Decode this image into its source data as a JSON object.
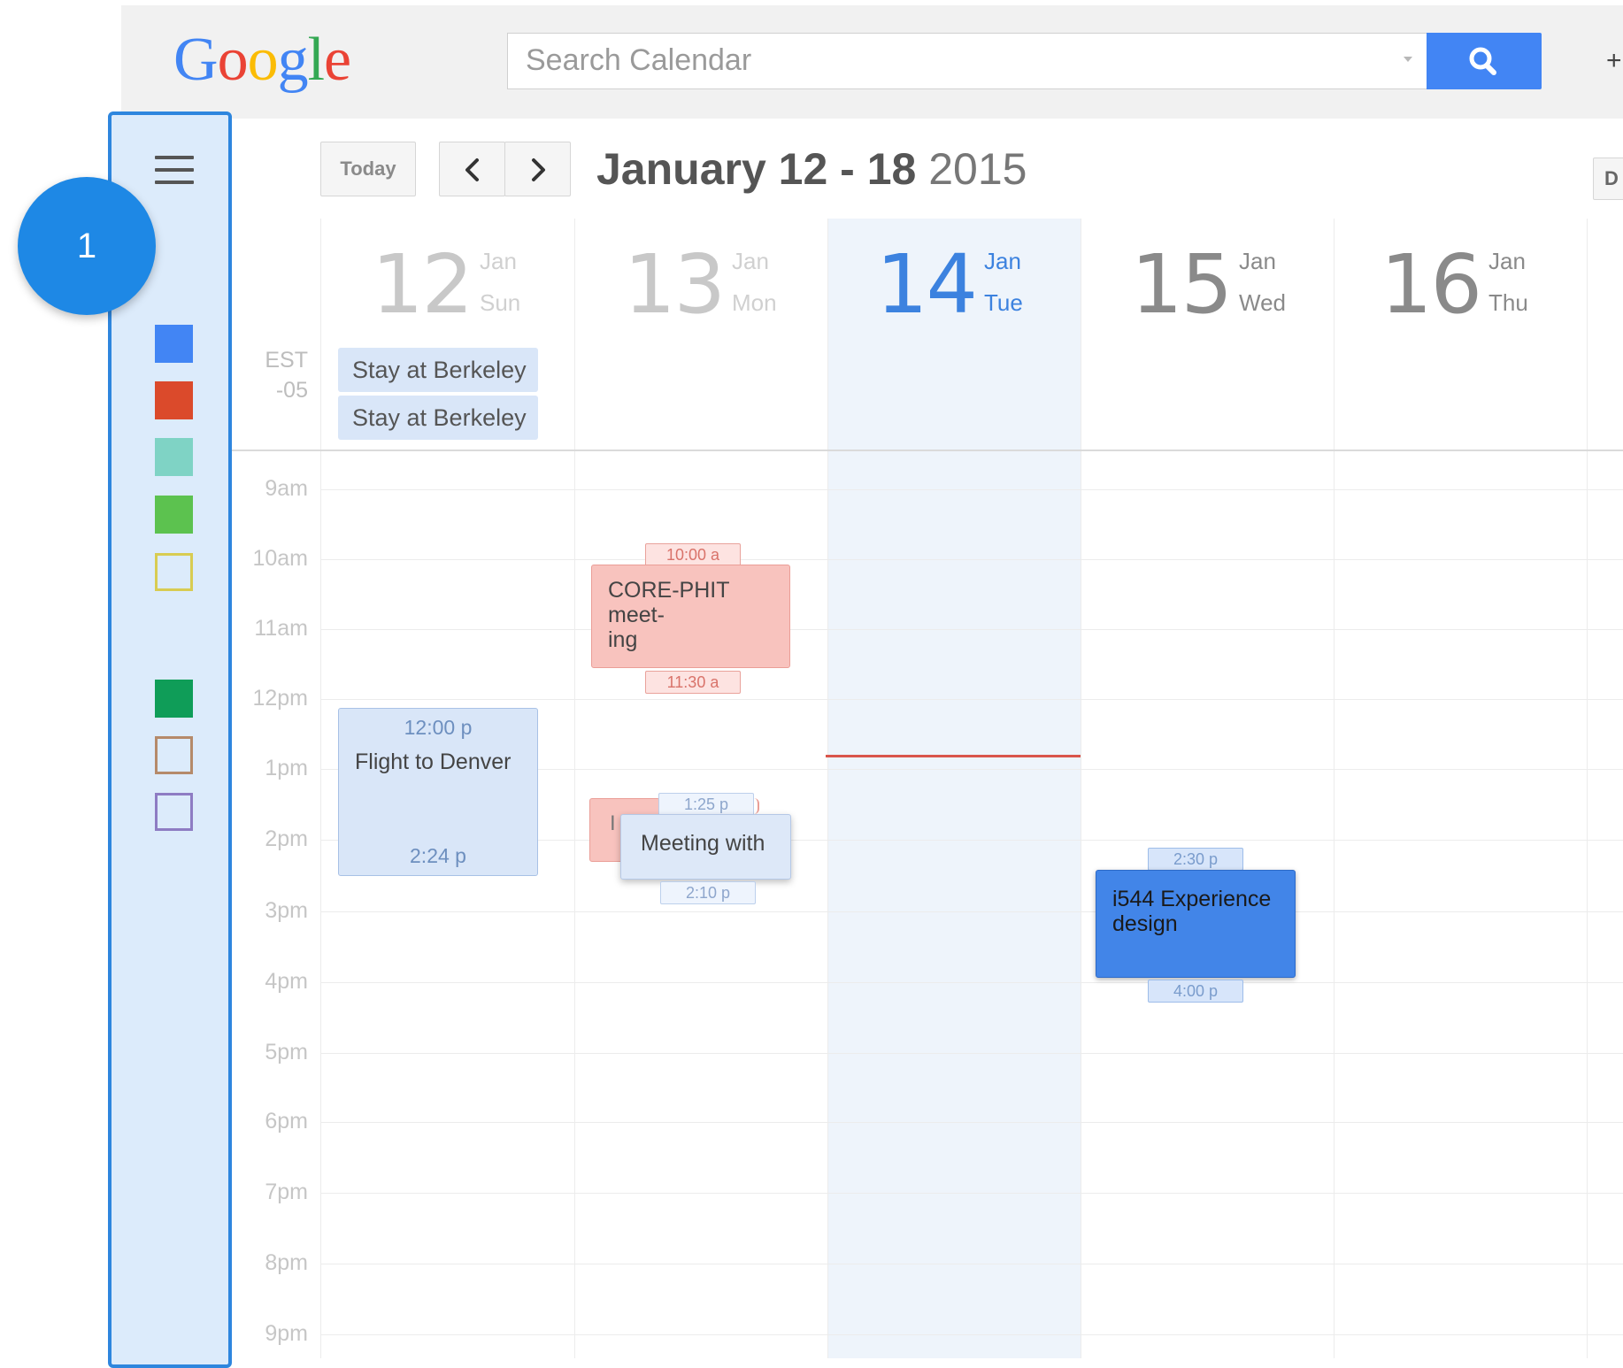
{
  "header": {
    "logo_letters": [
      "G",
      "o",
      "o",
      "g",
      "l",
      "e"
    ],
    "search_placeholder": "Search Calendar",
    "top_right_fragment": "+"
  },
  "toolbar": {
    "today_label": "Today",
    "prev_icon": "chevron-left-icon",
    "next_icon": "chevron-right-icon",
    "range_main": "January 12 - 18",
    "range_year": "2015",
    "view_fragment": "D"
  },
  "timezone": {
    "line1": "EST",
    "line2": "-05"
  },
  "days": [
    {
      "num": "12",
      "month": "Jan",
      "weekday": "Sun"
    },
    {
      "num": "13",
      "month": "Jan",
      "weekday": "Mon"
    },
    {
      "num": "14",
      "month": "Jan",
      "weekday": "Tue"
    },
    {
      "num": "15",
      "month": "Jan",
      "weekday": "Wed"
    },
    {
      "num": "16",
      "month": "Jan",
      "weekday": "Thu"
    }
  ],
  "hours": [
    "9am",
    "10am",
    "11am",
    "12pm",
    "1pm",
    "2pm",
    "3pm",
    "4pm",
    "5pm",
    "6pm",
    "7pm",
    "8pm",
    "9pm"
  ],
  "allday_events": [
    "Stay at Berkeley",
    "Stay at Berkeley"
  ],
  "events": {
    "core_phit": {
      "title": "CORE-PHIT meet-\ning",
      "start": "10:00 a",
      "end": "11:30 a"
    },
    "flight": {
      "title": "Flight to Denver",
      "start": "12:00 p",
      "end": "2:24 p"
    },
    "hidden_event": {
      "title": "I"
    },
    "meeting": {
      "title": "Meeting with",
      "start": "1:25 p",
      "end": "2:10 p"
    },
    "i544": {
      "title": "i544 Experience\ndesign",
      "start": "2:30 p",
      "end": "4:00 p"
    }
  },
  "sidebar": {
    "menu_icon": "hamburger-menu-icon",
    "calendar_colors": [
      {
        "color": "#4285f4",
        "filled": true
      },
      {
        "color": "#db4a2b",
        "filled": true
      },
      {
        "color": "#7fd3c5",
        "filled": true
      },
      {
        "color": "#5cc24f",
        "filled": true
      },
      {
        "color": "#d8cc52",
        "filled": false
      },
      {
        "color": "#0f9d58",
        "filled": true
      },
      {
        "color": "#b58a6a",
        "filled": false
      },
      {
        "color": "#8e7cc3",
        "filled": false
      }
    ],
    "step_badge": "1"
  },
  "colors": {
    "accent": "#4285f4",
    "highlight_border": "#2e86de",
    "now_line": "#d9554b"
  }
}
